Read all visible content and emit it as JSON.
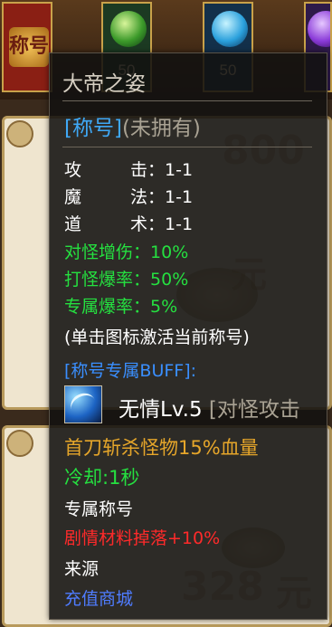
{
  "slots": [
    {
      "badge": "称号",
      "count": ""
    },
    {
      "badge": "",
      "count": "50"
    },
    {
      "badge": "",
      "count": "50"
    },
    {
      "badge": "",
      "count": ""
    }
  ],
  "background": {
    "card1_amount": "800",
    "card1_unit": "元",
    "card2_amount": "328",
    "card2_unit": "元"
  },
  "tooltip": {
    "title": "大帝之姿",
    "rank_tag": "[称号]",
    "rank_status": "(未拥有)",
    "stats": [
      {
        "label": "攻　击",
        "value": "1-1",
        "color": "white"
      },
      {
        "label": "魔　法",
        "value": "1-1",
        "color": "white"
      },
      {
        "label": "道　术",
        "value": "1-1",
        "color": "white"
      },
      {
        "label": "对怪增伤",
        "value": "10%",
        "color": "green"
      },
      {
        "label": "打怪爆率",
        "value": "50%",
        "color": "green"
      },
      {
        "label": "专属爆率",
        "value": "5%",
        "color": "green"
      }
    ],
    "hint": "(单击图标激活当前称号)",
    "buff_header": "[称号专属BUFF]:",
    "skill": {
      "name": "无情Lv.5",
      "desc": "[对怪攻击"
    },
    "effect": "首刀斩杀怪物15%血量",
    "cooldown": "冷却:1秒",
    "exclusive": "专属称号",
    "drop_bonus": "剧情材料掉落+10%",
    "source_label": "来源",
    "source_value": "充值商城"
  },
  "colors": {
    "rank_tag": "#3fa8f5",
    "stat_green": "#25e040",
    "effect_orange": "#e6a62a",
    "drop_red": "#ff2a2a",
    "source_blue": "#4f7cff"
  }
}
